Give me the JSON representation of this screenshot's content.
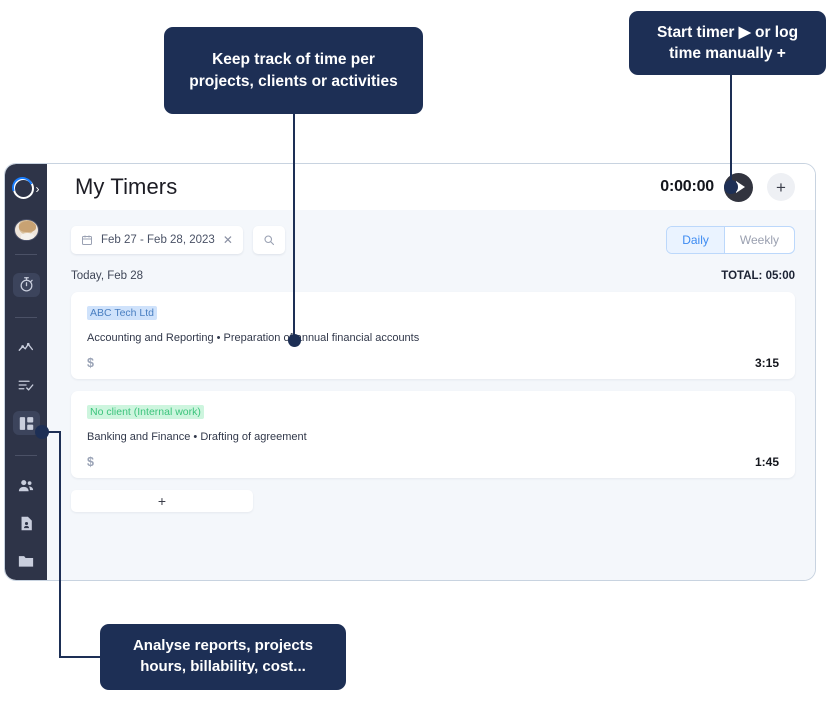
{
  "callouts": {
    "track": "Keep track of time per projects, clients or activities",
    "timer": "Start timer ▶ or log time manually  +",
    "reports": "Analyse reports, projects hours,  billability, cost..."
  },
  "sidebar": {
    "logo": "logo-ring-icon",
    "expand": "›",
    "avatar": "user-avatar",
    "items": [
      {
        "name": "timer",
        "icon": "stopwatch-icon",
        "active": true
      },
      {
        "name": "analytics",
        "icon": "chart-line-icon",
        "active": false
      },
      {
        "name": "tasks",
        "icon": "list-check-icon",
        "active": false
      },
      {
        "name": "dashboard",
        "icon": "dashboard-grid-icon",
        "active": true
      },
      {
        "name": "clients",
        "icon": "people-icon",
        "active": false
      },
      {
        "name": "documents",
        "icon": "document-icon",
        "active": false
      },
      {
        "name": "files",
        "icon": "folder-icon",
        "active": false
      }
    ]
  },
  "header": {
    "title": "My Timers",
    "timer_value": "0:00:00",
    "play_label": "play-icon",
    "add_label": "+"
  },
  "filters": {
    "date_range": "Feb 27 - Feb 28, 2023",
    "clear_label": "✕",
    "search_placeholder": "Search",
    "view_modes": [
      {
        "label": "Daily",
        "active": true
      },
      {
        "label": "Weekly",
        "active": false
      }
    ]
  },
  "day": {
    "label": "Today, Feb 28",
    "total": "TOTAL: 05:00"
  },
  "entries": [
    {
      "client": "ABC Tech Ltd",
      "client_color": "blue",
      "description": "Accounting and Reporting • Preparation of annual financial accounts",
      "billable": "$",
      "duration": "3:15"
    },
    {
      "client": "No client (Internal work)",
      "client_color": "green",
      "description": "Banking and Finance • Drafting of agreement",
      "billable": "$",
      "duration": "1:45"
    }
  ],
  "add_entry_label": "+",
  "colors": {
    "callout_bg": "#1d2f55",
    "sidebar_bg": "#2e3448",
    "panel_bg": "#f4f7fb",
    "accent_blue": "#3d8bf2",
    "tag_blue_bg": "#cfe2fb",
    "tag_blue_text": "#4a7fc1",
    "tag_green_bg": "#cdf5de",
    "tag_green_text": "#3cc47c"
  }
}
